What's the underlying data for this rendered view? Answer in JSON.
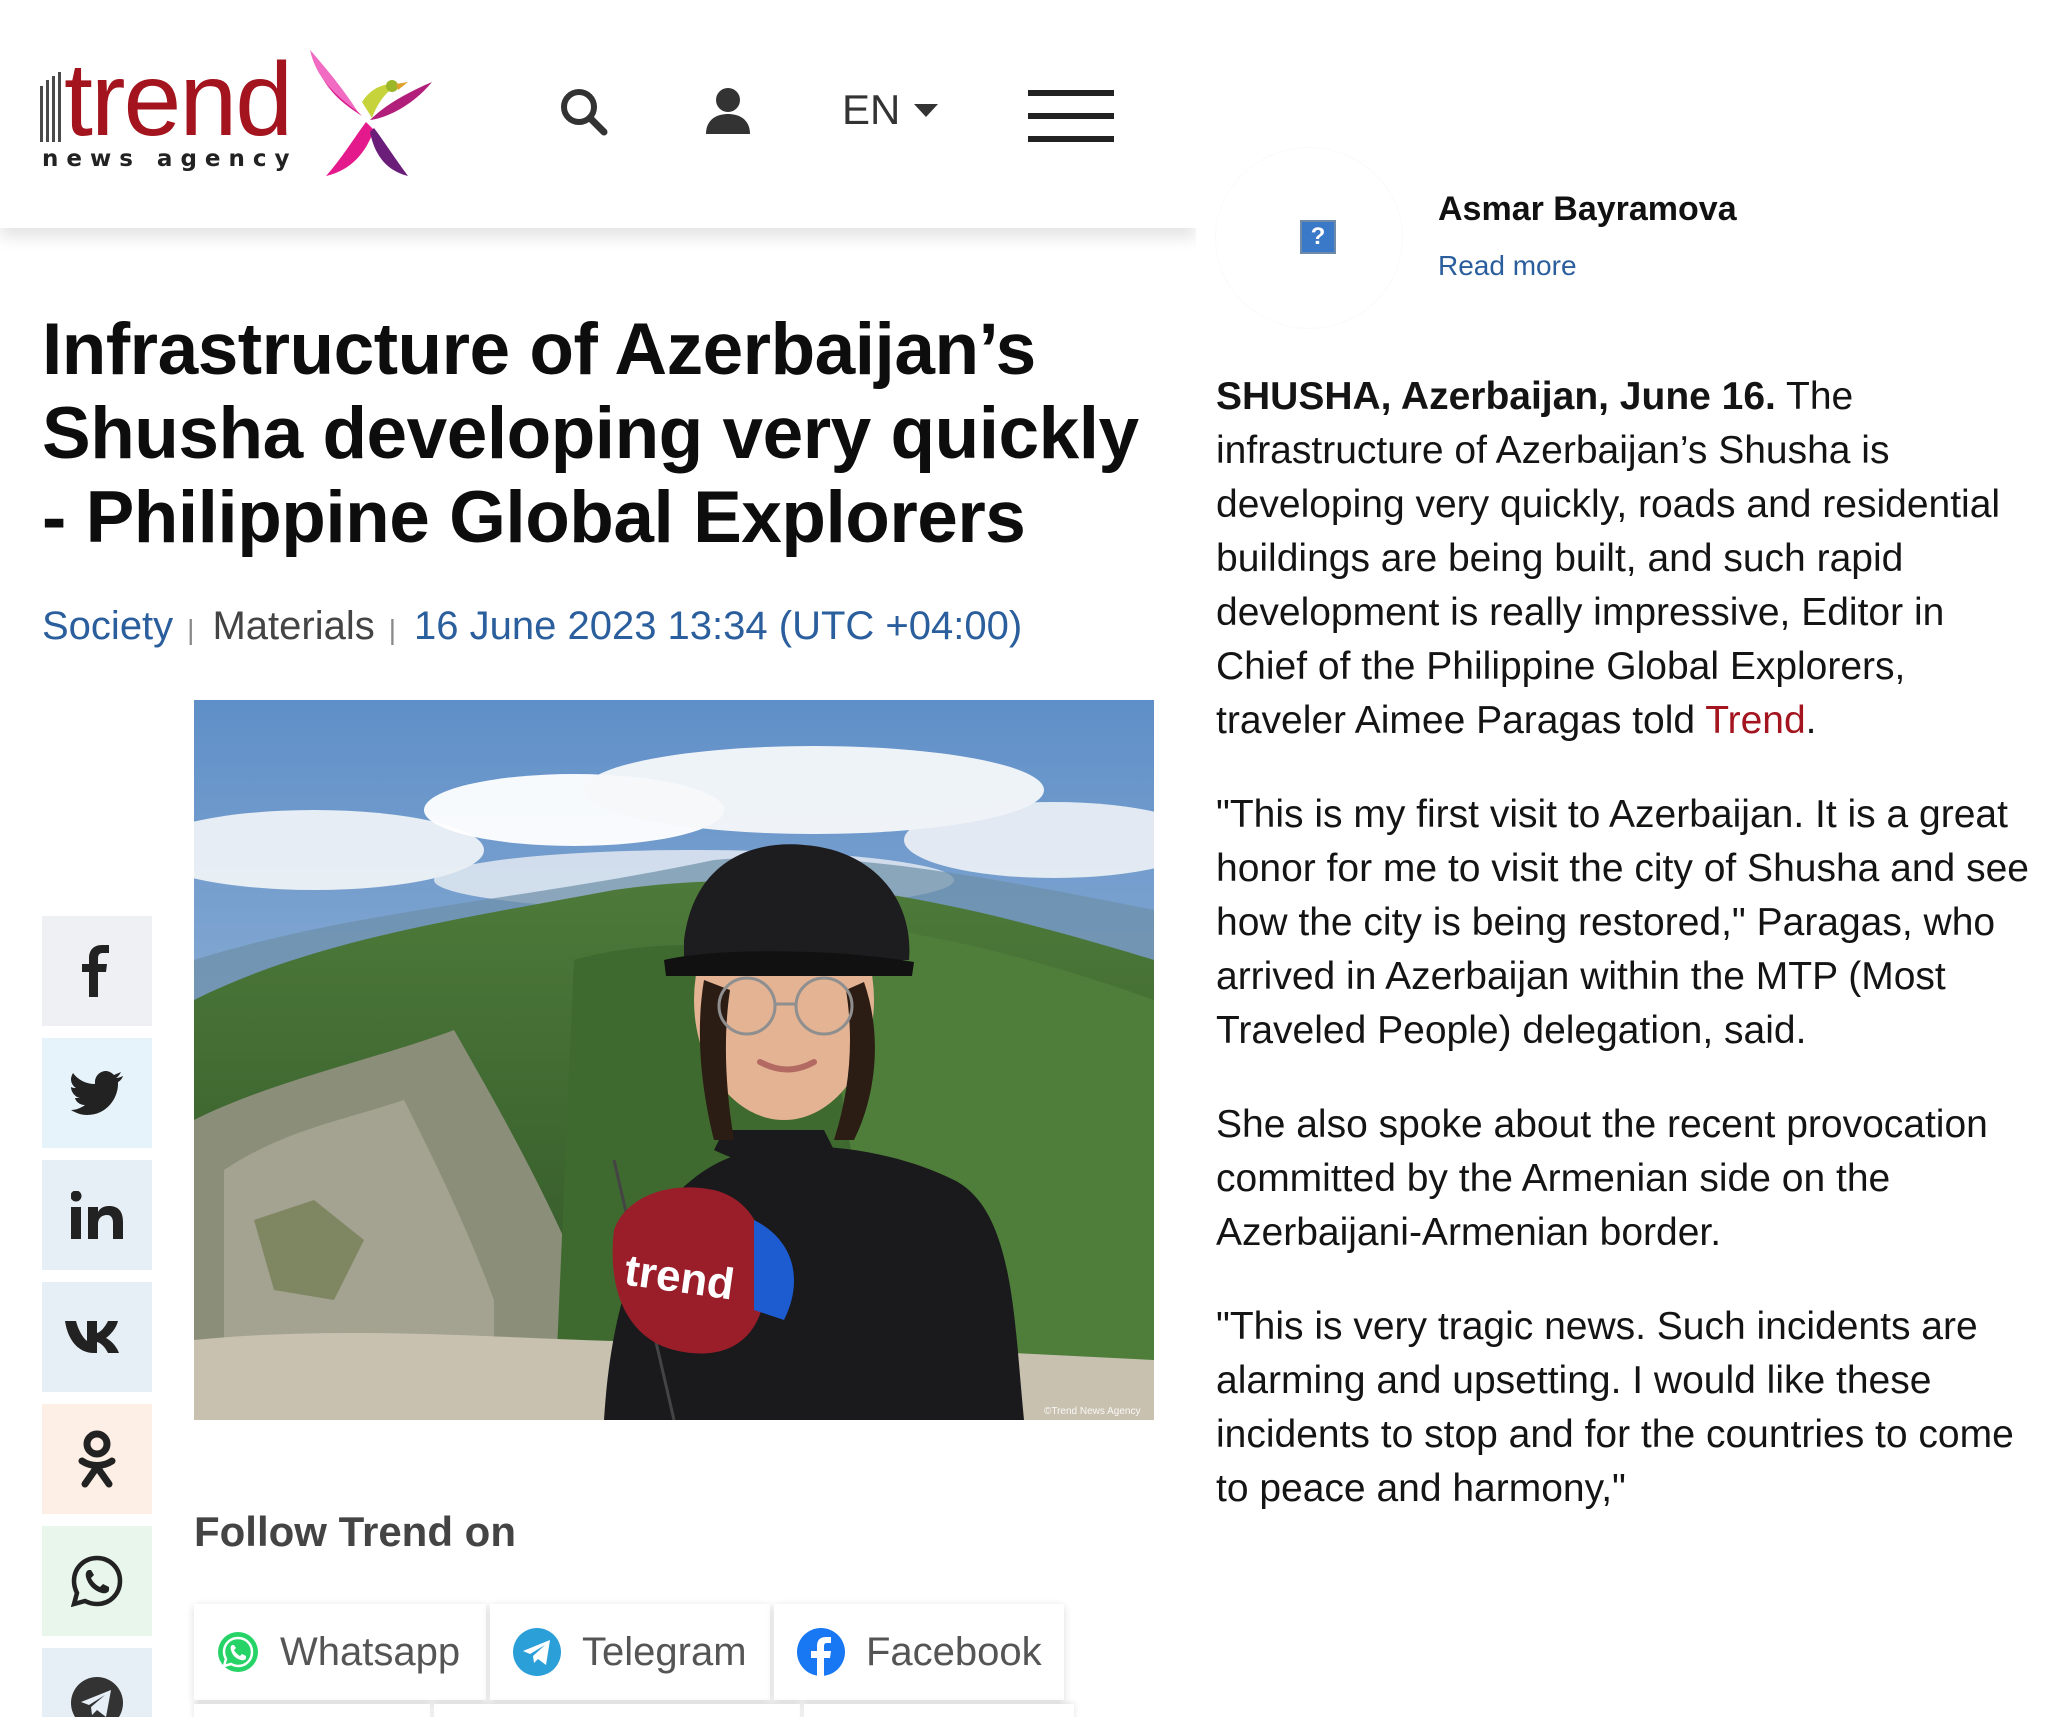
{
  "header": {
    "logo_word": "trend",
    "logo_sub": "news agency",
    "lang": "EN"
  },
  "article": {
    "title": "Infrastructure of Azerbaijan’s Shusha developing very quickly - Philippine Global Explorers",
    "category": "Society",
    "section": "Materials",
    "date": "16 June 2023 13:34 (UTC +04:00)",
    "image_mic_label": "trend",
    "image_credit": "©Trend News Agency"
  },
  "share": {
    "items": [
      {
        "name": "facebook",
        "icon": "facebook-icon"
      },
      {
        "name": "twitter",
        "icon": "twitter-icon"
      },
      {
        "name": "linkedin",
        "icon": "linkedin-icon"
      },
      {
        "name": "vk",
        "icon": "vk-icon"
      },
      {
        "name": "odnoklassniki",
        "icon": "odnoklassniki-icon"
      },
      {
        "name": "whatsapp",
        "icon": "whatsapp-icon"
      },
      {
        "name": "telegram",
        "icon": "telegram-icon"
      }
    ]
  },
  "follow": {
    "title": "Follow Trend on",
    "whatsapp": "Whatsapp",
    "telegram": "Telegram",
    "facebook": "Facebook"
  },
  "author": {
    "name": "Asmar Bayramova",
    "read_more": "Read more"
  },
  "body": {
    "p1_lead": "SHUSHA, Azerbaijan, June 16.",
    "p1_text": " The infrastructure of Azerbaijan’s Shusha is developing very quickly, roads and residential buildings are being built, and such rapid development is really impressive, Editor in Chief of the Philippine Global Explorers, traveler Aimee Paragas told ",
    "p1_link": "Trend",
    "p1_end": ".",
    "p2": "\"This is my first visit to Azerbaijan. It is a great honor for me to visit the city of Shusha and see how the city is being restored,\" Paragas, who arrived in Azerbaijan within the MTP (Most Traveled People) delegation, said.",
    "p3": "She also spoke about the recent provocation committed by the Armenian side on the Azerbaijani-Armenian border.",
    "p4": "\"This is very tragic news. Such incidents are alarming and upsetting. I would like these incidents to stop and for the countries to come to peace and harmony,\""
  },
  "colors": {
    "brand_red": "#a3141e",
    "link_blue": "#2a5e9c"
  }
}
